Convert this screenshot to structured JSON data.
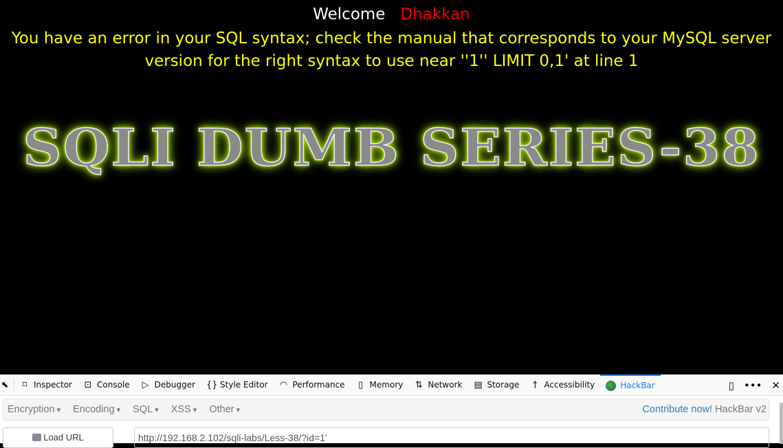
{
  "page": {
    "welcome": "Welcome",
    "user": "Dhakkan",
    "error": "You have an error in your SQL syntax; check the manual that corresponds to your MySQL server version for the right syntax to use near ''1'' LIMIT 0,1' at line 1",
    "logo": "SQLI DUMB SERIES-38"
  },
  "devtools": {
    "tabs": [
      {
        "label": "Inspector",
        "icon": "inspector-icon"
      },
      {
        "label": "Console",
        "icon": "console-icon"
      },
      {
        "label": "Debugger",
        "icon": "debugger-icon"
      },
      {
        "label": "Style Editor",
        "icon": "style-editor-icon"
      },
      {
        "label": "Performance",
        "icon": "performance-icon"
      },
      {
        "label": "Memory",
        "icon": "memory-icon"
      },
      {
        "label": "Network",
        "icon": "network-icon"
      },
      {
        "label": "Storage",
        "icon": "storage-icon"
      },
      {
        "label": "Accessibility",
        "icon": "accessibility-icon"
      },
      {
        "label": "HackBar",
        "icon": "hackbar-icon",
        "active": true
      }
    ]
  },
  "hackbar": {
    "menus": [
      "Encryption",
      "Encoding",
      "SQL",
      "XSS",
      "Other"
    ],
    "contribute": "Contribute now!",
    "version": "HackBar v2",
    "load_url": "Load URL",
    "url": "http://192.168.2.102/sqli-labs/Less-38/?id=1'"
  },
  "colors": {
    "accent": "#0a84ff",
    "error": "#ffff00",
    "user": "#e00000"
  }
}
